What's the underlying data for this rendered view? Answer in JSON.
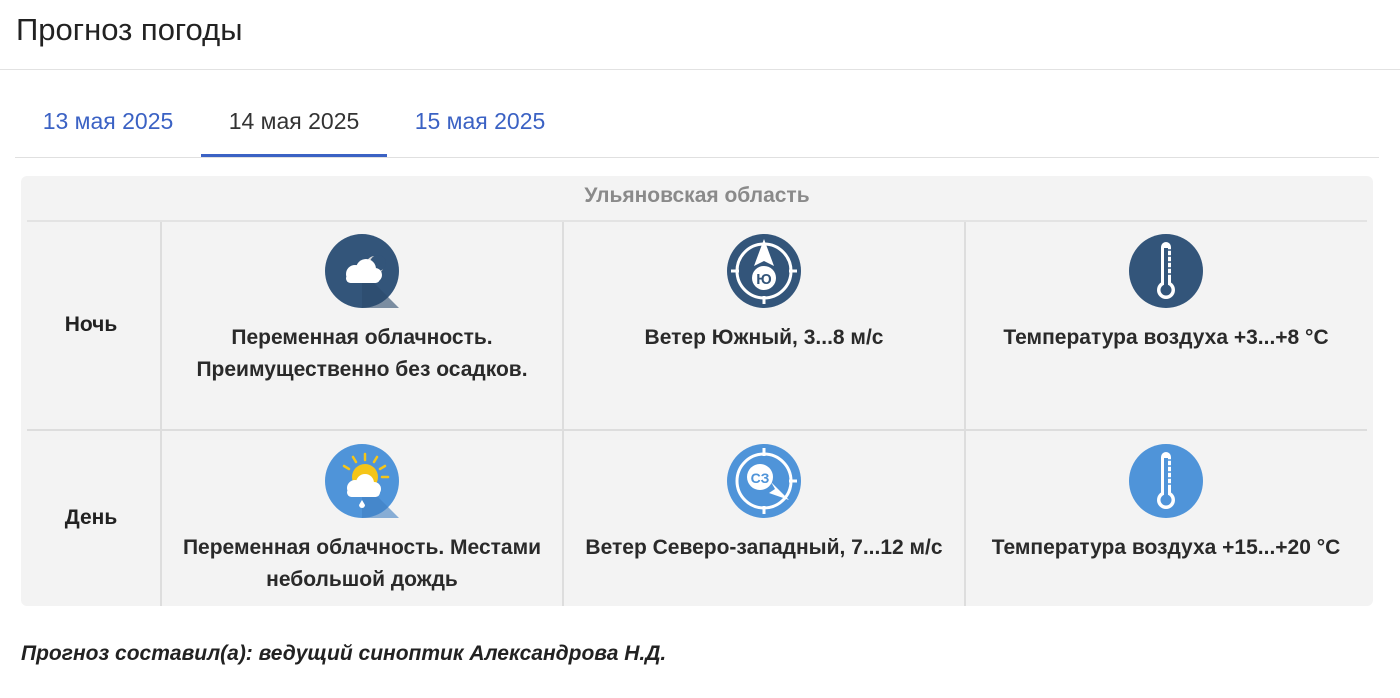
{
  "page": {
    "title": "Прогноз погоды"
  },
  "tabs": [
    {
      "label": "13 мая 2025",
      "active": false
    },
    {
      "label": "14 мая 2025",
      "active": true
    },
    {
      "label": "15 мая 2025",
      "active": false
    }
  ],
  "forecast": {
    "region": "Ульяновская область",
    "rows": [
      {
        "period": "Ночь",
        "sky": {
          "icon": "night-cloudy-icon",
          "text": "Переменная облачность. Преимущественно без осадков."
        },
        "wind": {
          "icon": "wind-direction-south-icon",
          "letter": "Ю",
          "text": "Ветер Южный, 3...8 м/с"
        },
        "temp": {
          "icon": "thermometer-icon",
          "text": "Температура воздуха +3...+8 °С"
        }
      },
      {
        "period": "День",
        "sky": {
          "icon": "day-cloudy-rain-icon",
          "text": "Переменная облачность. Местами небольшой дождь"
        },
        "wind": {
          "icon": "wind-direction-northwest-icon",
          "letter": "СЗ",
          "text": "Ветер Северо-западный, 7...12 м/с"
        },
        "temp": {
          "icon": "thermometer-icon",
          "text": "Температура воздуха +15...+20 °С"
        }
      }
    ]
  },
  "colors": {
    "night": "#33557a",
    "day": "#4f94d9",
    "link": "#3b62c4"
  },
  "footer": {
    "author": "Прогноз составил(а): ведущий синоптик Александрова Н.Д."
  }
}
